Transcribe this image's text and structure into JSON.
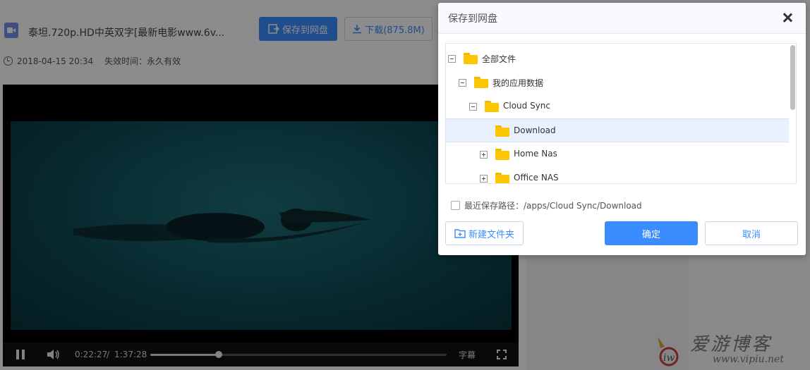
{
  "file": {
    "title": "泰坦.720p.HD中英双字[最新电影www.6v...",
    "save_button": "保存到网盘",
    "download_button": "下载(875.8M)",
    "date": "2018-04-15 20:34",
    "expire": "失效时间：永久有效"
  },
  "player": {
    "current_time": "0:22:27",
    "separator": "/",
    "total_time": "1:37:28",
    "progress_fraction": 0.23,
    "subtitle_label": "字幕"
  },
  "dialog": {
    "title": "保存到网盘",
    "tree": [
      {
        "label": "全部文件",
        "toggle": "minus",
        "level": 0,
        "selected": false
      },
      {
        "label": "我的应用数据",
        "toggle": "minus",
        "level": 1,
        "selected": false
      },
      {
        "label": "Cloud Sync",
        "toggle": "minus",
        "level": 2,
        "selected": false
      },
      {
        "label": "Download",
        "toggle": "none",
        "level": 3,
        "selected": true
      },
      {
        "label": "Home Nas",
        "toggle": "plus",
        "level": 3,
        "selected": false
      },
      {
        "label": "Office NAS",
        "toggle": "plus",
        "level": 3,
        "selected": false
      }
    ],
    "recent_path": "最近保存路径：/apps/Cloud Sync/Download",
    "new_folder_button": "新建文件夹",
    "ok_button": "确定",
    "cancel_button": "取消"
  },
  "watermark": {
    "text": "爱游博客",
    "url": "www.vipiu.net"
  },
  "colors": {
    "accent": "#3b8cff",
    "folder": "#fec600",
    "selected_row": "#e8f1fd"
  }
}
